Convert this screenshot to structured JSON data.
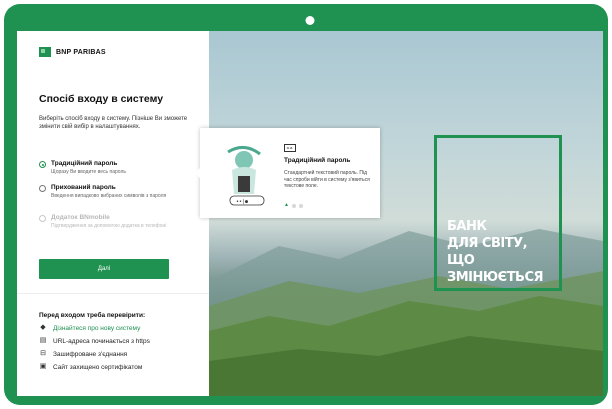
{
  "logo": {
    "text": "BNP PARIBAS"
  },
  "login": {
    "title": "Спосіб входу в систему",
    "description": "Виберіть спосіб входу в систему. Пізніше Ви зможете змінити свій вибір в налаштуваннях.",
    "options": [
      {
        "label": "Традиційний пароль",
        "sub": "Щоразу Ви вводите весь пароль",
        "selected": true,
        "enabled": true
      },
      {
        "label": "Прихований пароль",
        "sub": "Введення випадково вибраних символів з пароля",
        "selected": false,
        "enabled": true
      },
      {
        "label": "Додаток BNmobile",
        "sub": "Підтвердження за допомогою додатка в телефоні",
        "selected": false,
        "enabled": false
      }
    ],
    "next_button": "Далі"
  },
  "checks": {
    "title": "Перед входом треба перевірити:",
    "items": [
      {
        "icon": "diamond-icon",
        "text": "Дізнайтеся про нову систему",
        "link": true
      },
      {
        "icon": "browser-icon",
        "text": "URL-адреса починається з https",
        "link": false
      },
      {
        "icon": "lock-icon",
        "text": "Зашифроване з'єднання",
        "link": false
      },
      {
        "icon": "certificate-icon",
        "text": "Сайт захищено сертифікатом",
        "link": false
      }
    ]
  },
  "popup": {
    "icon_text": "a.a.",
    "title": "Традиційний пароль",
    "description": "Стандартний текстовий пароль. Під час спроби війти в систему з'явиться текстове поле.",
    "illus_field": "••|●"
  },
  "banner": {
    "slogan": "БАНК\nДЛЯ СВІТУ,\nЩО ЗМІНЮЄТЬСЯ"
  },
  "colors": {
    "brand_green": "#1f9150",
    "frame": "#1f9150"
  }
}
